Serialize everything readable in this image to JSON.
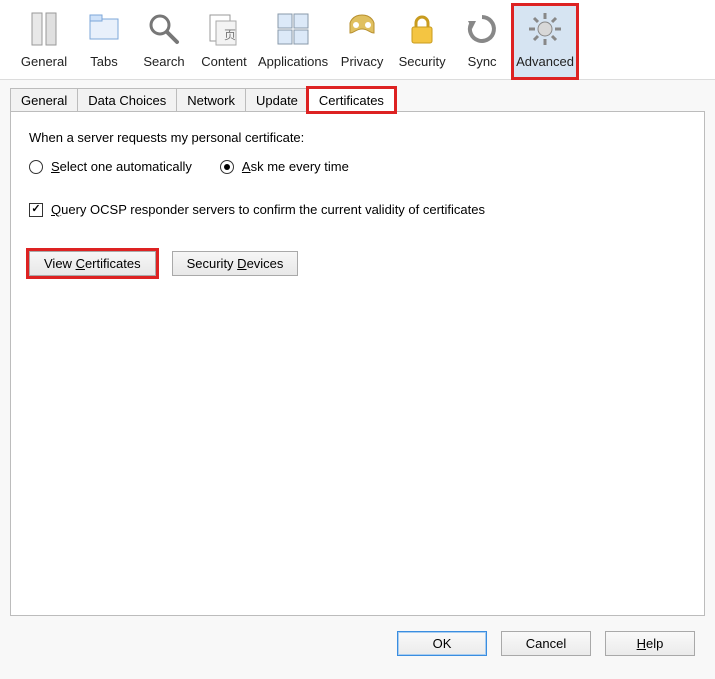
{
  "categories": [
    {
      "id": "general",
      "label": "General"
    },
    {
      "id": "tabs",
      "label": "Tabs"
    },
    {
      "id": "search",
      "label": "Search"
    },
    {
      "id": "content",
      "label": "Content"
    },
    {
      "id": "applications",
      "label": "Applications"
    },
    {
      "id": "privacy",
      "label": "Privacy"
    },
    {
      "id": "security",
      "label": "Security"
    },
    {
      "id": "sync",
      "label": "Sync"
    },
    {
      "id": "advanced",
      "label": "Advanced",
      "active": true,
      "highlight": true
    }
  ],
  "subtabs": [
    {
      "id": "adv-general",
      "label": "General"
    },
    {
      "id": "adv-data-choices",
      "label": "Data Choices"
    },
    {
      "id": "adv-network",
      "label": "Network"
    },
    {
      "id": "adv-update",
      "label": "Update"
    },
    {
      "id": "adv-certificates",
      "label": "Certificates",
      "active": true,
      "highlight": true
    }
  ],
  "cert": {
    "prompt": "When a server requests my personal certificate:",
    "radio_auto": {
      "pre": "",
      "u": "S",
      "post": "elect one automatically"
    },
    "radio_ask": {
      "pre": "",
      "u": "A",
      "post": "sk me every time"
    },
    "radio_selected": "ask",
    "ocsp": {
      "pre": "",
      "u": "Q",
      "post": "uery OCSP responder servers to confirm the current validity of certificates"
    },
    "ocsp_checked": true,
    "view_btn": {
      "pre": "View ",
      "u": "C",
      "post": "ertificates"
    },
    "devices_btn": {
      "pre": "Security ",
      "u": "D",
      "post": "evices"
    }
  },
  "dialog": {
    "ok": "OK",
    "cancel": "Cancel",
    "help": {
      "pre": "",
      "u": "H",
      "post": "elp"
    }
  }
}
